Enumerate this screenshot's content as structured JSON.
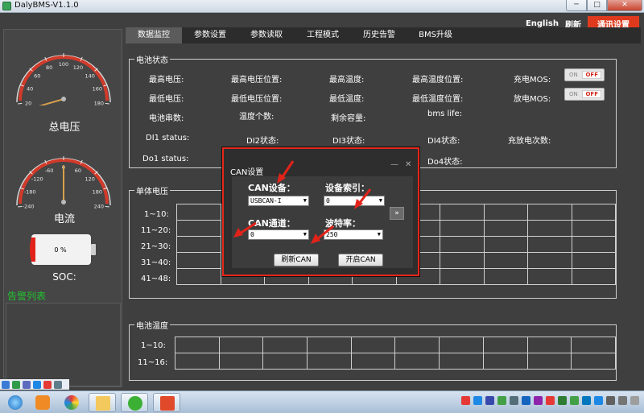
{
  "window": {
    "title": "DalyBMS-V1.1.0",
    "min": "─",
    "max": "□",
    "close": "✕"
  },
  "topbar": {
    "english": "English",
    "refresh": "刷新",
    "comm_settings": "通讯设置"
  },
  "tabs": [
    "数据监控",
    "参数设置",
    "参数读取",
    "工程模式",
    "历史告警",
    "BMS升级"
  ],
  "left": {
    "voltage_gauge": {
      "label": "总电压",
      "ticks": [
        "0",
        "20",
        "40",
        "60",
        "80",
        "100",
        "120",
        "140",
        "160",
        "180",
        "200"
      ],
      "value": 0
    },
    "current_gauge": {
      "label": "电流",
      "ticks": [
        "-300",
        "-240",
        "-180",
        "-120",
        "-60",
        "0",
        "60",
        "120",
        "180",
        "240",
        "300"
      ],
      "value": 0
    },
    "soc": {
      "label": "SOC:",
      "value": "0 %"
    },
    "alarm_list": "告警列表"
  },
  "battery_status": {
    "title": "电池状态",
    "fields": [
      [
        "最高电压:",
        "最高电压位置:",
        "最高温度:",
        "最高温度位置:",
        "充电MOS:"
      ],
      [
        "最低电压:",
        "最低电压位置:",
        "最低温度:",
        "最低温度位置:",
        "放电MOS:"
      ],
      [
        "电池串数:",
        "温度个数:",
        "剩余容量:",
        "bms life:"
      ],
      [
        "DI1 status:",
        "DI2状态:",
        "DI3状态:",
        "DI4状态:",
        "充放电次数:"
      ],
      [
        "Do1 status:",
        "Do4状态:"
      ]
    ],
    "toggle": {
      "on": "ON",
      "off": "OFF"
    }
  },
  "cell_voltage": {
    "title": "单体电压",
    "rows": [
      "1~10:",
      "11~20:",
      "21~30:",
      "31~40:",
      "41~48:"
    ]
  },
  "cell_temp": {
    "title": "电池温度",
    "rows": [
      "1~10:",
      "11~16:"
    ]
  },
  "can_dialog": {
    "title": "CAN设置",
    "min": "—",
    "close": "✕",
    "device_label": "CAN设备：",
    "device_value": "USBCAN-I",
    "index_label": "设备索引：",
    "index_value": "0",
    "channel_label": "CAN通道：",
    "channel_value": "0",
    "baud_label": "波特率：",
    "baud_value": "250",
    "expand": "»",
    "refresh_btn": "刷新CAN",
    "open_btn": "开启CAN"
  },
  "colors": {
    "accent_red": "#e03a1e",
    "alarm_green": "#22c32f",
    "bg": "#3f3f3f"
  }
}
